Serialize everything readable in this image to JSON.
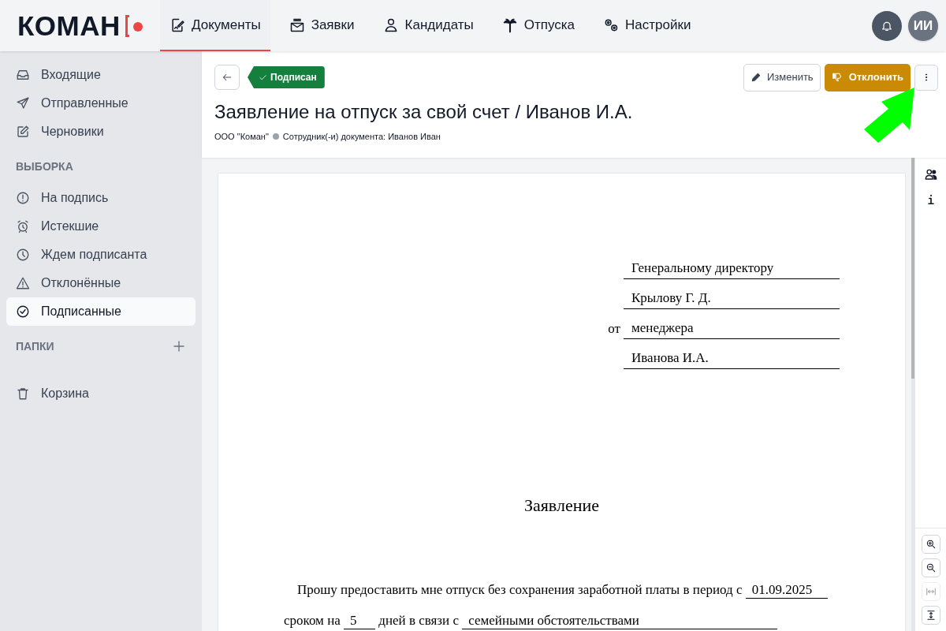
{
  "logo": {
    "text": "КОМАН"
  },
  "nav": [
    {
      "label": "Документы",
      "selected": true
    },
    {
      "label": "Заявки",
      "selected": false
    },
    {
      "label": "Кандидаты",
      "selected": false
    },
    {
      "label": "Отпуска",
      "selected": false
    },
    {
      "label": "Настройки",
      "selected": false
    }
  ],
  "user": {
    "initials": "ИИ"
  },
  "sidebar": {
    "items": [
      {
        "label": "Входящие",
        "selected": false
      },
      {
        "label": "Отправленные",
        "selected": false
      },
      {
        "label": "Черновики",
        "selected": false
      }
    ],
    "sections": [
      {
        "title": "ВЫБОРКА",
        "addable": false,
        "items": [
          {
            "label": "На подпись",
            "selected": false
          },
          {
            "label": "Истекшие",
            "selected": false
          },
          {
            "label": "Ждем подписанта",
            "selected": false
          },
          {
            "label": "Отклонённые",
            "selected": false
          },
          {
            "label": "Подписанные",
            "selected": true
          }
        ]
      },
      {
        "title": "ПАПКИ",
        "addable": true
      }
    ],
    "trash": {
      "label": "Корзина"
    }
  },
  "document": {
    "status": "Подписан",
    "title": "Заявление на отпуск за свой счет / Иванов И.А.",
    "organization": "ООО \"Коман\"",
    "employees": "Сотрудник(-и) документа: Иванов Иван",
    "actions": [
      {
        "label": "Изменить",
        "kind": "edit"
      },
      {
        "label": "Отклонить",
        "kind": "reject"
      }
    ]
  },
  "page": {
    "addressee": [
      {
        "value": "Генеральному директору"
      },
      {
        "value": "Крылову Г. Д."
      },
      {
        "prefix": "от",
        "value": "менеджера"
      },
      {
        "value": "Иванова И.А."
      }
    ],
    "heading": "Заявление",
    "body": [
      [
        {
          "text": "Прошу предоставить мне отпуск без сохранения заработной платы в период с ",
          "field": false
        },
        {
          "text": "01.09.2025",
          "field": true
        }
      ],
      [
        {
          "text": "сроком на ",
          "field": false
        },
        {
          "text": "5",
          "field": true
        },
        {
          "text": " дней в связи с ",
          "field": false
        },
        {
          "text": "семейными обстоятельствами",
          "field": true
        }
      ]
    ]
  }
}
